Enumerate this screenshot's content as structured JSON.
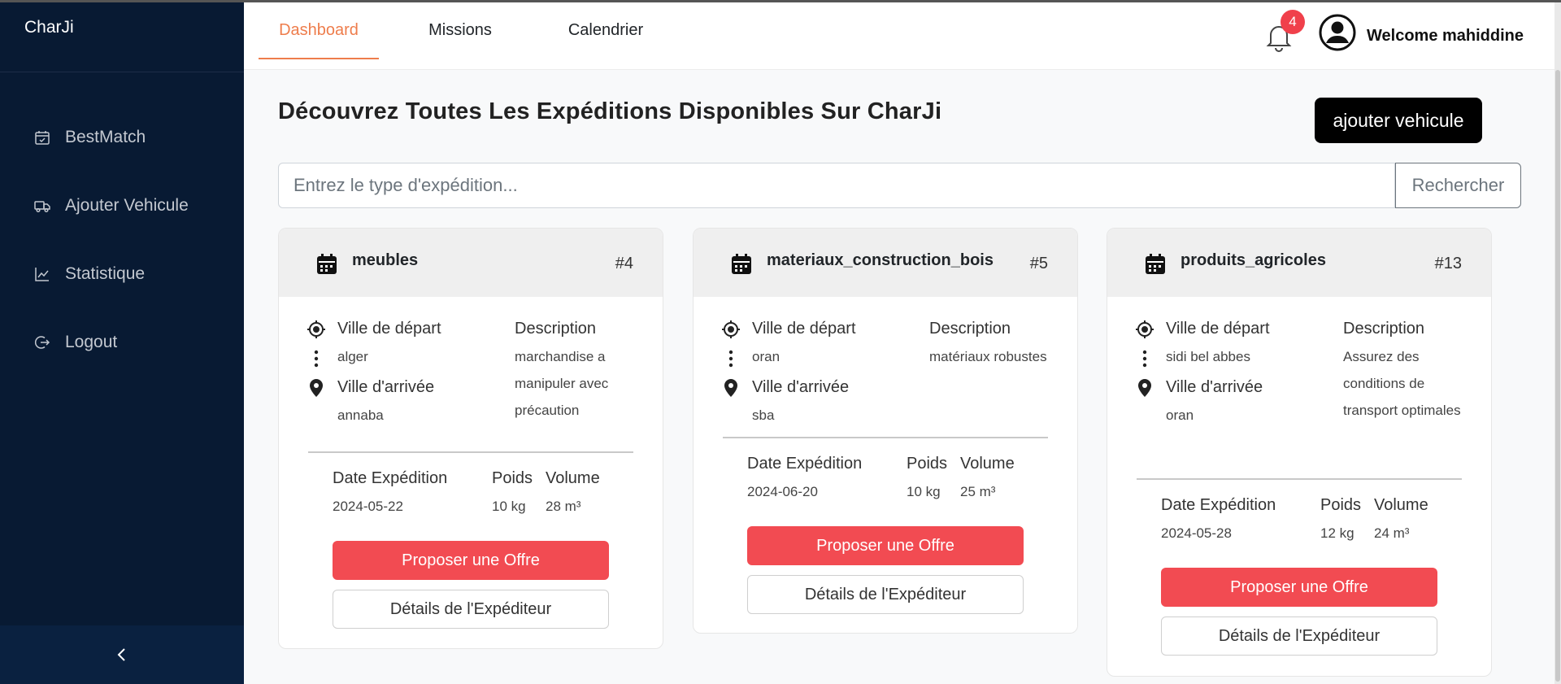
{
  "brand": "CharJi",
  "sidebar": {
    "items": [
      {
        "label": "BestMatch",
        "icon": "calendar-check-icon"
      },
      {
        "label": "Ajouter Vehicule",
        "icon": "truck-icon"
      },
      {
        "label": "Statistique",
        "icon": "line-chart-icon"
      },
      {
        "label": "Logout",
        "icon": "logout-icon"
      }
    ],
    "collapse_icon": "chevron-left-icon"
  },
  "header": {
    "tabs": [
      {
        "label": "Dashboard",
        "active": true
      },
      {
        "label": "Missions",
        "active": false
      },
      {
        "label": "Calendrier",
        "active": false
      }
    ],
    "notification_count": "4",
    "welcome": "Welcome mahiddine"
  },
  "main": {
    "title": "Découvrez Toutes Les Expéditions Disponibles Sur CharJi",
    "add_vehicle_label": "ajouter vehicule",
    "search": {
      "placeholder": "Entrez le type d'expédition...",
      "value": "",
      "button_label": "Rechercher"
    }
  },
  "card_labels": {
    "depart": "Ville de départ",
    "arrivee": "Ville d'arrivée",
    "description": "Description",
    "date": "Date Expédition",
    "poids": "Poids",
    "volume": "Volume",
    "offer": "Proposer une Offre",
    "details": "Détails de l'Expéditeur"
  },
  "cards": [
    {
      "title": "meubles",
      "id": "#4",
      "depart": "alger",
      "arrivee": "annaba",
      "description": "marchandise a manipuler avec précaution",
      "date": "2024-05-22",
      "poids": "10 kg",
      "volume": "28 m³"
    },
    {
      "title": "materiaux_construction_bois",
      "id": "#5",
      "depart": "oran",
      "arrivee": "sba",
      "description": "matériaux robustes",
      "date": "2024-06-20",
      "poids": "10 kg",
      "volume": "25 m³"
    },
    {
      "title": "produits_agricoles",
      "id": "#13",
      "depart": "sidi bel abbes",
      "arrivee": "oran",
      "description": "Assurez des conditions de transport optimales",
      "date": "2024-05-28",
      "poids": "12 kg",
      "volume": "24 m³"
    }
  ],
  "colors": {
    "sidebar": "#081a33",
    "accent": "#ee7d4c",
    "offer": "#f24b52",
    "badge": "#f0404b"
  }
}
